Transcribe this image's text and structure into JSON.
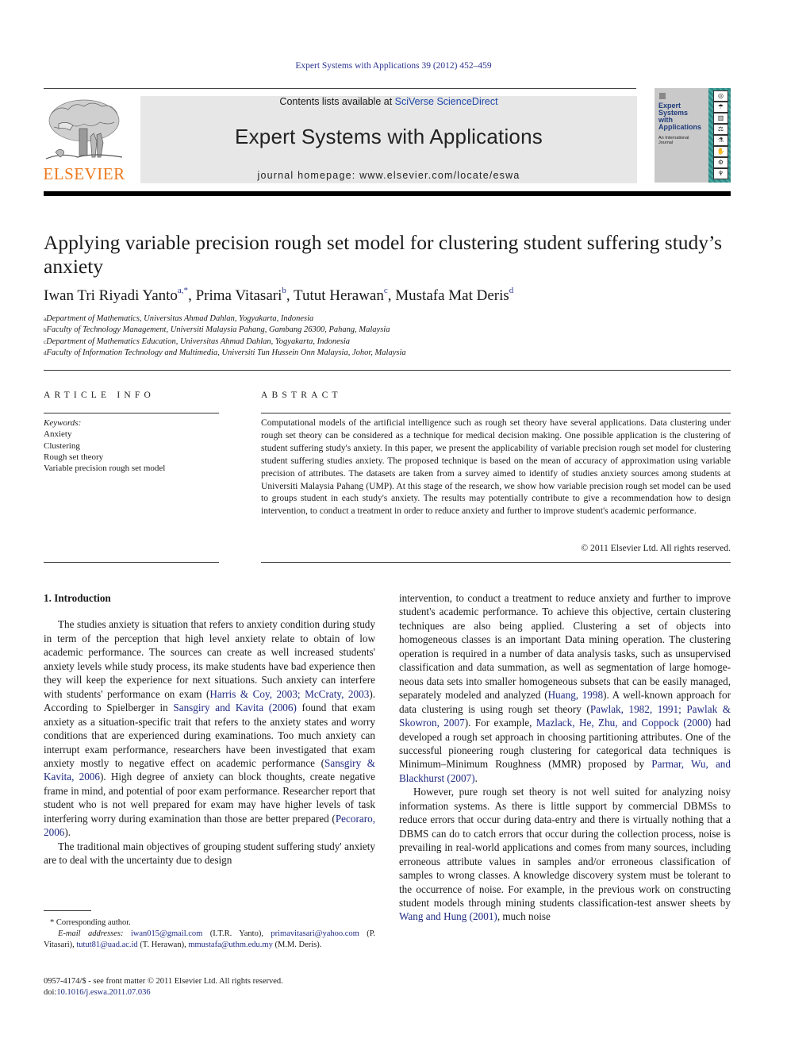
{
  "journal_ref": "Expert Systems with Applications 39 (2012) 452–459",
  "masthead": {
    "contents_prefix": "Contents lists available at ",
    "contents_link": "SciVerse ScienceDirect",
    "journal_title": "Expert Systems with Applications",
    "homepage": "journal homepage: www.elsevier.com/locate/eswa",
    "publisher_wordmark": "ELSEVIER",
    "publisher_color": "#ee7a1e",
    "band_color": "#e7e7e7"
  },
  "cover": {
    "title_lines": [
      "Expert",
      "Systems",
      "with",
      "Applications"
    ],
    "subtitle_lines": [
      "An International",
      "Journal"
    ],
    "icons": [
      "◎",
      "☂",
      "▥",
      "⚖",
      "⚗",
      "✋",
      "⚙",
      "♆"
    ]
  },
  "article": {
    "title": "Applying variable precision rough set model for clustering student suffering study’s anxiety",
    "authors": [
      {
        "name": "Iwan Tri Riyadi Yanto",
        "mark": "a,*"
      },
      {
        "name": "Prima Vitasari",
        "mark": "b"
      },
      {
        "name": "Tutut Herawan",
        "mark": "c"
      },
      {
        "name": "Mustafa Mat Deris",
        "mark": "d"
      }
    ],
    "affiliations": [
      {
        "mark": "a",
        "text": "Department of Mathematics, Universitas Ahmad Dahlan, Yogyakarta, Indonesia"
      },
      {
        "mark": "b",
        "text": "Faculty of Technology Management, Universiti Malaysia Pahang, Gambang 26300, Pahang, Malaysia"
      },
      {
        "mark": "c",
        "text": "Department of Mathematics Education, Universitas Ahmad Dahlan, Yogyakarta, Indonesia"
      },
      {
        "mark": "d",
        "text": "Faculty of Information Technology and Multimedia, Universiti Tun Hussein Onn Malaysia, Johor, Malaysia"
      }
    ]
  },
  "article_info": {
    "label": "ARTICLE INFO",
    "keywords_label": "Keywords:",
    "keywords": [
      "Anxiety",
      "Clustering",
      "Rough set theory",
      "Variable precision rough set model"
    ]
  },
  "abstract": {
    "label": "ABSTRACT",
    "text": "Computational models of the artificial intelligence such as rough set theory have several applications. Data clustering under rough set theory can be considered as a technique for medical decision making. One possible application is the clustering of student suffering study's anxiety. In this paper, we present the applicability of variable precision rough set model for clustering student suffering studies anxiety. The proposed technique is based on the mean of accuracy of approximation using variable precision of attributes. The datasets are taken from a survey aimed to identify of studies anxiety sources among stu­dents at Universiti Malaysia Pahang (UMP). At this stage of the research, we show how variable precision rough set model can be used to groups student in each study's anxiety. The results may potentially con­tribute to give a recommendation how to design intervention, to conduct a treatment in order to reduce anxiety and further to improve student's academic performance.",
    "copyright": "© 2011 Elsevier Ltd. All rights reserved."
  },
  "body": {
    "section_heading": "1. Introduction",
    "left": {
      "p1": [
        {
          "t": "The studies anxiety is situation that refers to anxiety condition during study in term of the perception that high level anxiety relate to obtain of low academic performance. The sources can cre­ate as well increased students' anxiety levels while study process, its make students have bad experience then they will keep the experience for next situations. Such anxiety can interfere with stu­dents' performance on exam ("
        },
        {
          "t": "Harris & Coy, 2003; McCraty, 2003",
          "link": true
        },
        {
          "t": "). According to Spielberger in "
        },
        {
          "t": "Sansgiry and Kavita (2006)",
          "link": true
        },
        {
          "t": " found that exam anxiety as a situation-specific trait that refers to the anxiety states and worry conditions that are experienced during examina­tions. Too much anxiety can interrupt exam performance, researchers have been investigated that exam anxiety mostly to negative effect on academic performance ("
        },
        {
          "t": "Sansgiry & Kavita, 2006",
          "link": true
        },
        {
          "t": "). High degree of anxiety can block thoughts, create negative frame in mind, and potential of poor exam performance. Research­er report that student who is not well prepared for exam may have higher levels of task interfering worry during examination than those are better prepared ("
        },
        {
          "t": "Pecoraro, 2006",
          "link": true
        },
        {
          "t": ")."
        }
      ],
      "p2": "The traditional main objectives of grouping student suffering study' anxiety are to deal with the uncertainty due to design"
    },
    "right": {
      "p1": [
        {
          "t": "intervention, to conduct a treatment to reduce anxiety and further to improve student's academic performance. To achieve this objec­tive, certain clustering techniques are also being applied. Cluster­ing a set of objects into homogeneous classes is an important Data mining operation. The clustering operation is required in a number of data analysis tasks, such as unsupervised classification and data summation, as well as segmentation of large homoge­neous data sets into smaller homogeneous subsets that can be eas­ily managed, separately modeled and analyzed ("
        },
        {
          "t": "Huang, 1998",
          "link": true
        },
        {
          "t": "). A well-known approach for data clustering is using rough set theory ("
        },
        {
          "t": "Pawlak, 1982, 1991; Pawlak & Skowron, 2007",
          "link": true
        },
        {
          "t": "). For example, "
        },
        {
          "t": "Mazlack, He, Zhu, and Coppock (2000)",
          "link": true
        },
        {
          "t": " had developed a rough set approach in choosing partitioning attributes. One of the successful pioneering rough clustering for categorical data techniques is Minimum–Minimum Roughness (MMR) proposed by "
        },
        {
          "t": "Parmar, Wu, and Blackhurst (2007)",
          "link": true
        },
        {
          "t": "."
        }
      ],
      "p2": [
        {
          "t": "However, pure rough set theory is not well suited for analyzing noisy information systems. As there is little support by commercial DBMSs to reduce errors that occur during data-entry and there is virtually nothing that a DBMS can do to catch errors that occur dur­ing the collection process, noise is prevailing in real-world applica­tions and comes from many sources, including erroneous attribute values in samples and/or erroneous classification of samples to wrong classes. A knowledge discovery system must be tolerant to the occurrence of noise. For example, in the previous work on constructing student models through mining students classifica­tion-test answer sheets by "
        },
        {
          "t": "Wang and Hung (2001)",
          "link": true
        },
        {
          "t": ", much noise"
        }
      ]
    }
  },
  "footnotes": {
    "corresponding": "* Corresponding author.",
    "email_label": "E-mail addresses:",
    "emails": [
      {
        "email": "iwan015@gmail.com",
        "who": "(I.T.R. Yanto),"
      },
      {
        "email": "primavitasari@yahoo.com",
        "who": "(P. Vitasari),"
      },
      {
        "email": "tutut81@uad.ac.id",
        "who": "(T. Herawan),"
      },
      {
        "email": "mmustafa@uthm.edu.my",
        "who": "(M.M. Deris)."
      }
    ],
    "front_matter": "0957-4174/$ - see front matter © 2011 Elsevier Ltd. All rights reserved.",
    "doi_prefix": "doi:",
    "doi": "10.1016/j.eswa.2011.07.036"
  },
  "colors": {
    "link": "#1f2a80",
    "sciencedirect_link": "#2048a8"
  }
}
